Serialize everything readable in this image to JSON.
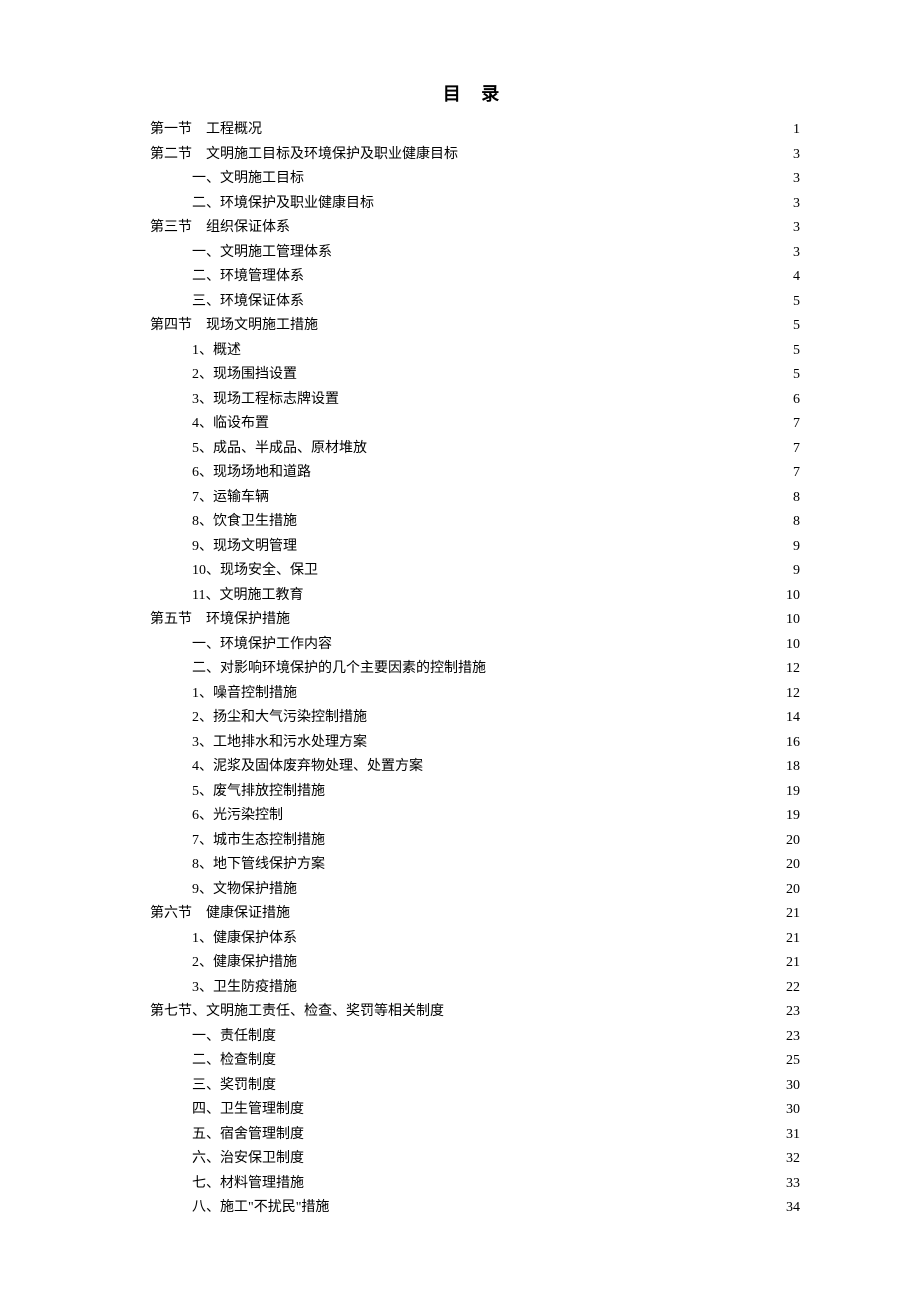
{
  "title": "目  录",
  "entries": [
    {
      "level": 0,
      "prefix": "第一节",
      "label": "工程概况",
      "page": "1"
    },
    {
      "level": 0,
      "prefix": "第二节",
      "label": "文明施工目标及环境保护及职业健康目标",
      "page": "3"
    },
    {
      "level": 1,
      "prefix": "",
      "label": "一、文明施工目标",
      "page": "3"
    },
    {
      "level": 1,
      "prefix": "",
      "label": "二、环境保护及职业健康目标",
      "page": "3"
    },
    {
      "level": 0,
      "prefix": "第三节",
      "label": "组织保证体系",
      "page": "3"
    },
    {
      "level": 1,
      "prefix": "",
      "label": "一、文明施工管理体系",
      "page": "3"
    },
    {
      "level": 1,
      "prefix": "",
      "label": "二、环境管理体系",
      "page": "4"
    },
    {
      "level": 1,
      "prefix": "",
      "label": "三、环境保证体系",
      "page": "5"
    },
    {
      "level": 0,
      "prefix": "第四节",
      "label": "现场文明施工措施",
      "page": "5"
    },
    {
      "level": 1,
      "prefix": "",
      "label": "1、概述",
      "page": "5"
    },
    {
      "level": 1,
      "prefix": "",
      "label": "2、现场围挡设置",
      "page": "5"
    },
    {
      "level": 1,
      "prefix": "",
      "label": "3、现场工程标志牌设置",
      "page": "6"
    },
    {
      "level": 1,
      "prefix": "",
      "label": "4、临设布置",
      "page": "7"
    },
    {
      "level": 1,
      "prefix": "",
      "label": "5、成品、半成品、原材堆放",
      "page": "7"
    },
    {
      "level": 1,
      "prefix": "",
      "label": "6、现场场地和道路",
      "page": "7"
    },
    {
      "level": 1,
      "prefix": "",
      "label": "7、运输车辆",
      "page": "8"
    },
    {
      "level": 1,
      "prefix": "",
      "label": "8、饮食卫生措施",
      "page": "8"
    },
    {
      "level": 1,
      "prefix": "",
      "label": "9、现场文明管理",
      "page": "9"
    },
    {
      "level": 1,
      "prefix": "",
      "label": "10、现场安全、保卫",
      "page": "9"
    },
    {
      "level": 1,
      "prefix": "",
      "label": "11、文明施工教育",
      "page": "10"
    },
    {
      "level": 0,
      "prefix": "第五节",
      "label": "环境保护措施",
      "page": "10"
    },
    {
      "level": 1,
      "prefix": "",
      "label": "一、环境保护工作内容",
      "page": "10"
    },
    {
      "level": 1,
      "prefix": "",
      "label": "二、对影响环境保护的几个主要因素的控制措施",
      "page": "12"
    },
    {
      "level": 1,
      "prefix": "",
      "label": "1、噪音控制措施",
      "page": "12"
    },
    {
      "level": 1,
      "prefix": "",
      "label": "2、扬尘和大气污染控制措施",
      "page": "14"
    },
    {
      "level": 1,
      "prefix": "",
      "label": "3、工地排水和污水处理方案",
      "page": "16"
    },
    {
      "level": 1,
      "prefix": "",
      "label": "4、泥浆及固体废弃物处理、处置方案",
      "page": "18"
    },
    {
      "level": 1,
      "prefix": "",
      "label": "5、废气排放控制措施",
      "page": "19"
    },
    {
      "level": 1,
      "prefix": "",
      "label": "6、光污染控制",
      "page": "19"
    },
    {
      "level": 1,
      "prefix": "",
      "label": "7、城市生态控制措施",
      "page": "20"
    },
    {
      "level": 1,
      "prefix": "",
      "label": "8、地下管线保护方案",
      "page": "20"
    },
    {
      "level": 1,
      "prefix": "",
      "label": "9、文物保护措施",
      "page": "20"
    },
    {
      "level": 0,
      "prefix": "第六节",
      "label": "健康保证措施",
      "page": "21"
    },
    {
      "level": 1,
      "prefix": "",
      "label": "1、健康保护体系",
      "page": "21"
    },
    {
      "level": 1,
      "prefix": "",
      "label": "2、健康保护措施",
      "page": "21"
    },
    {
      "level": 1,
      "prefix": "",
      "label": "3、卫生防疫措施",
      "page": "22"
    },
    {
      "level": 0,
      "prefix": "",
      "label": "第七节、文明施工责任、检查、奖罚等相关制度",
      "page": "23"
    },
    {
      "level": 1,
      "prefix": "",
      "label": "一、责任制度",
      "page": "23"
    },
    {
      "level": 1,
      "prefix": "",
      "label": "二、检查制度",
      "page": "25"
    },
    {
      "level": 1,
      "prefix": "",
      "label": "三、奖罚制度",
      "page": "30"
    },
    {
      "level": 1,
      "prefix": "",
      "label": "四、卫生管理制度",
      "page": "30"
    },
    {
      "level": 1,
      "prefix": "",
      "label": "五、宿舍管理制度",
      "page": "31"
    },
    {
      "level": 1,
      "prefix": "",
      "label": "六、治安保卫制度",
      "page": "32"
    },
    {
      "level": 1,
      "prefix": "",
      "label": "七、材料管理措施",
      "page": "33"
    },
    {
      "level": 1,
      "prefix": "",
      "label": "八、施工\"不扰民\"措施",
      "page": "34"
    }
  ]
}
